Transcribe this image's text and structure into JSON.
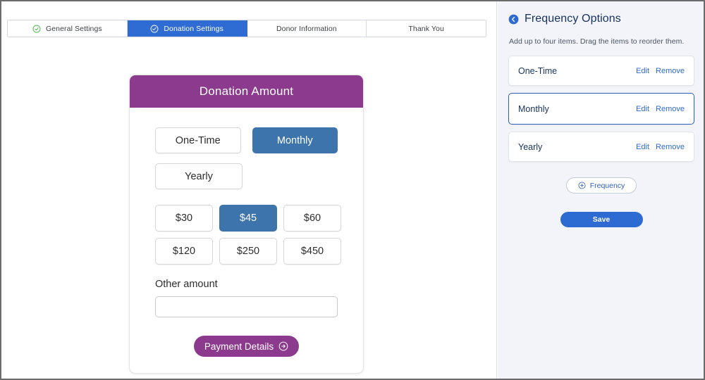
{
  "tabs": [
    {
      "label": "General Settings",
      "icon": "check-circle-icon",
      "state": "complete",
      "active": false
    },
    {
      "label": "Donation Settings",
      "icon": "check-circle-icon",
      "state": "complete",
      "active": true
    },
    {
      "label": "Donor Information",
      "icon": "",
      "state": "pending",
      "active": false
    },
    {
      "label": "Thank You",
      "icon": "",
      "state": "pending",
      "active": false
    }
  ],
  "preview_card": {
    "header_title": "Donation Amount",
    "frequency_options": [
      {
        "label": "One-Time",
        "selected": false
      },
      {
        "label": "Monthly",
        "selected": true
      },
      {
        "label": "Yearly",
        "selected": false
      }
    ],
    "amounts": [
      {
        "label": "$30",
        "selected": false
      },
      {
        "label": "$45",
        "selected": true
      },
      {
        "label": "$60",
        "selected": false
      },
      {
        "label": "$120",
        "selected": false
      },
      {
        "label": "$250",
        "selected": false
      },
      {
        "label": "$450",
        "selected": false
      }
    ],
    "other_amount_label": "Other amount",
    "other_amount_value": "",
    "other_amount_placeholder": "",
    "submit_label": "Payment Details",
    "submit_icon": "arrow-right-circle-icon"
  },
  "settings_panel": {
    "back_icon": "back-circle-icon",
    "title": "Frequency Options",
    "subtitle": "Add up to four items. Drag the items to reorder them.",
    "items": [
      {
        "label": "One-Time",
        "edit_label": "Edit",
        "remove_label": "Remove",
        "selected": false
      },
      {
        "label": "Monthly",
        "edit_label": "Edit",
        "remove_label": "Remove",
        "selected": true
      },
      {
        "label": "Yearly",
        "edit_label": "Edit",
        "remove_label": "Remove",
        "selected": false
      }
    ],
    "add_button": {
      "label": "Frequency",
      "icon": "plus-circle-icon"
    },
    "save_button": {
      "label": "Save"
    }
  },
  "colors": {
    "brand_purple": "#8b3a8e",
    "accent_blue": "#3d74ab",
    "tab_active_blue": "#2e6cd4",
    "link_blue": "#2d6ad1",
    "panel_bg": "#f2f4f9",
    "check_green": "#4bb543"
  }
}
